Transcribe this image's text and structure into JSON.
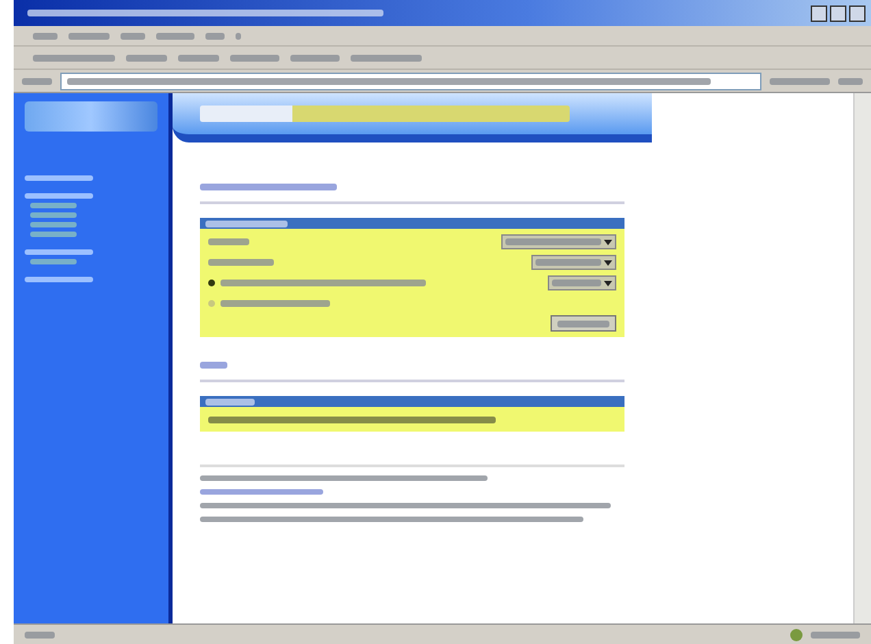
{
  "sidebar": {
    "items": [
      {
        "kind": "heading"
      },
      {
        "kind": "heading"
      },
      {
        "kind": "link"
      },
      {
        "kind": "link"
      },
      {
        "kind": "link"
      },
      {
        "kind": "link"
      },
      {
        "kind": "heading"
      },
      {
        "kind": "link"
      },
      {
        "kind": "heading"
      }
    ]
  },
  "settings_panel": {
    "rows": [
      {
        "kind": "dropdown"
      },
      {
        "kind": "dropdown"
      },
      {
        "kind": "radio_with_dropdown",
        "selected": true
      },
      {
        "kind": "radio",
        "selected": false
      }
    ]
  },
  "info_panel": {
    "rows": [
      {
        "kind": "text"
      }
    ]
  }
}
